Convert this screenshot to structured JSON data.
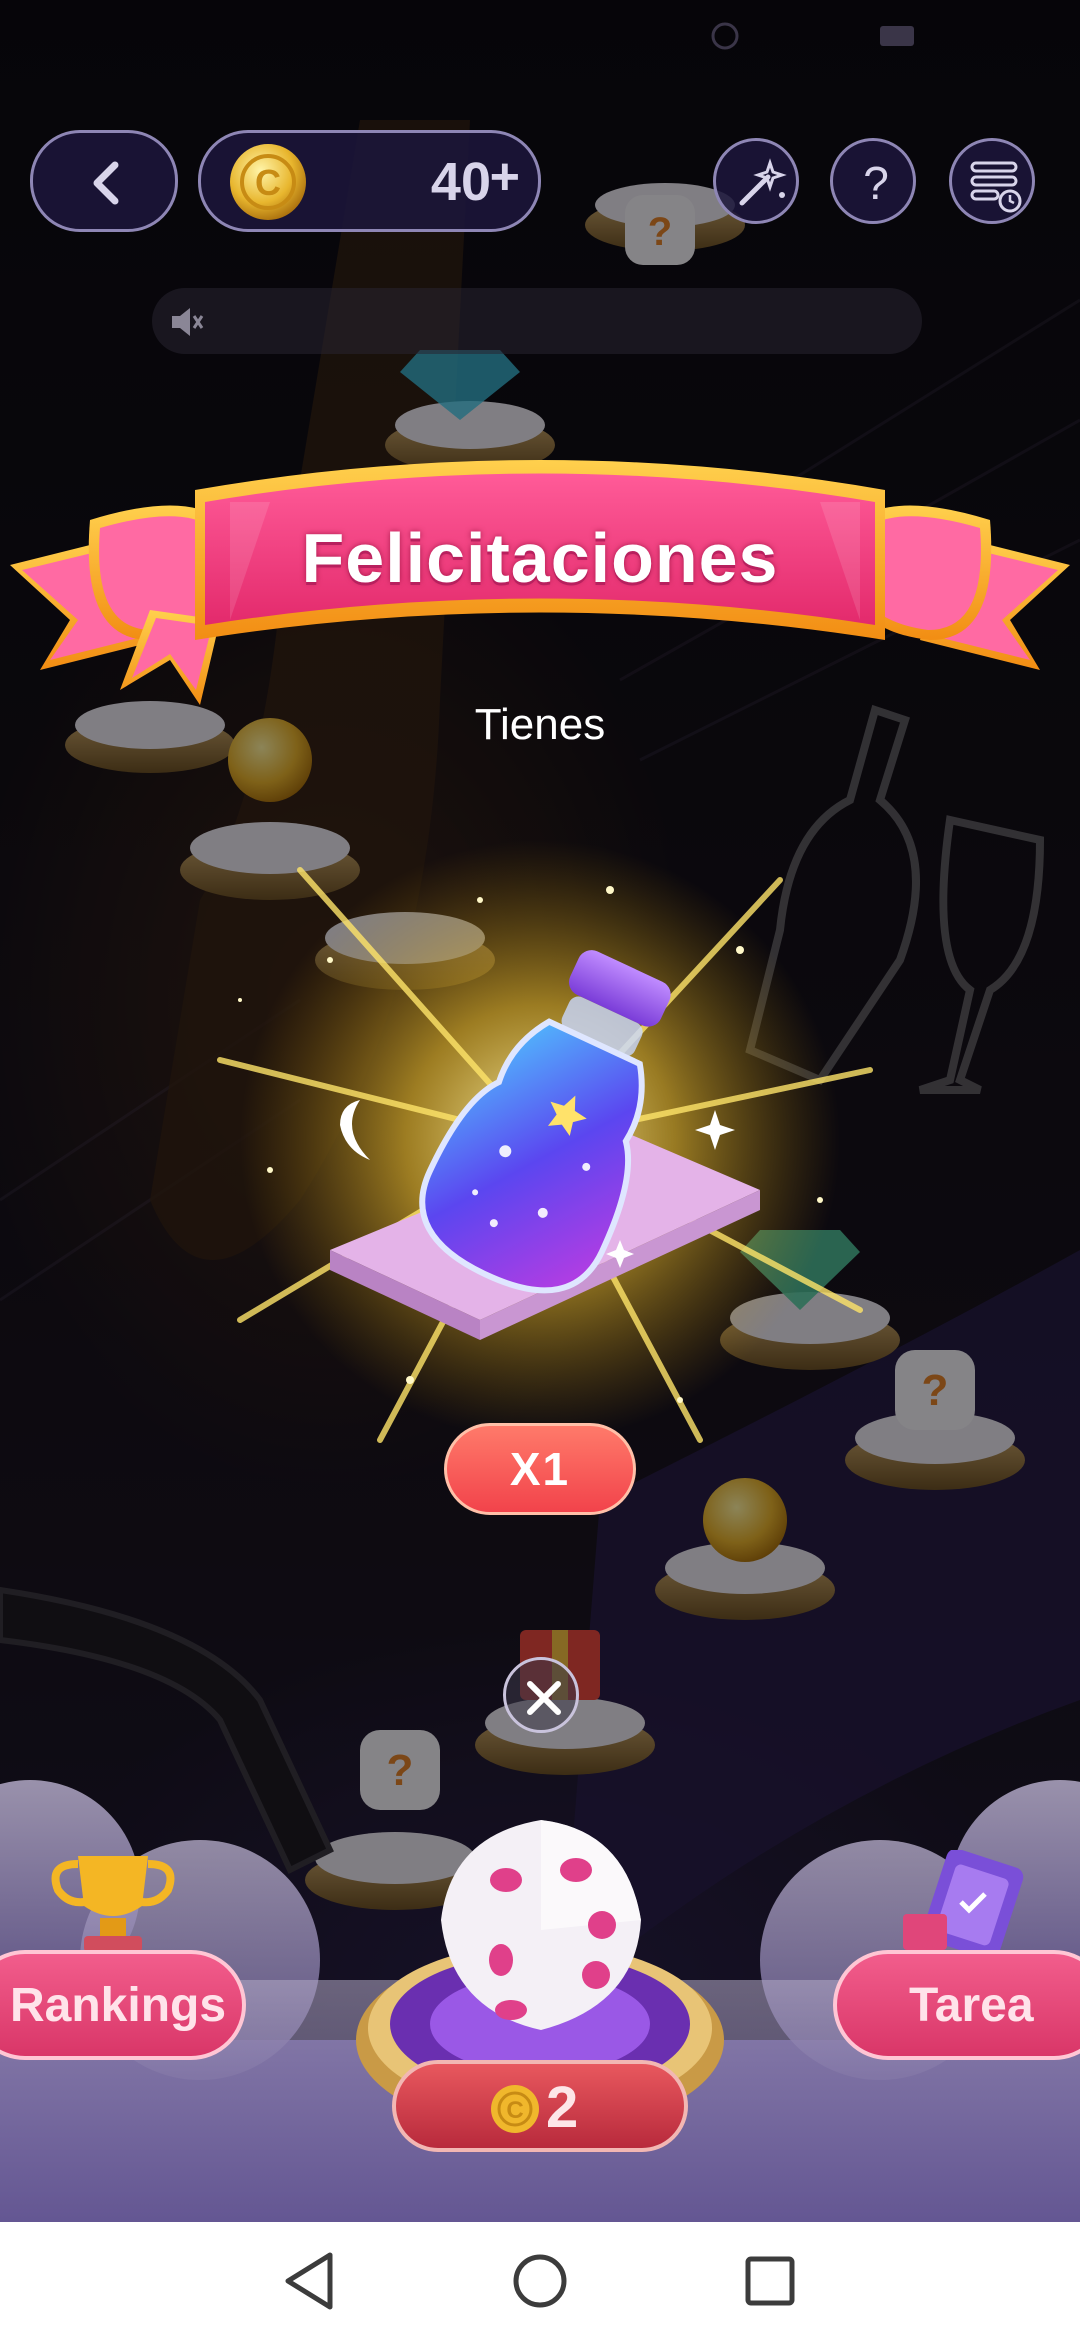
{
  "hud": {
    "coin_balance": "40",
    "coin_plus": "+"
  },
  "modal": {
    "title": "Felicitaciones",
    "subtitle": "Tienes",
    "reward_item_icon": "magic-potion-bottle-icon",
    "reward_quantity": "X1",
    "close_icon": "close-icon"
  },
  "bottom": {
    "rankings_label": "Rankings",
    "task_label": "Tarea",
    "roll_cost": "2",
    "dice_icon": "dice-icon"
  },
  "colors": {
    "banner_pink": "#f0427f",
    "banner_gold": "#f7a524",
    "pill_red": "#f2434b",
    "hud_border": "#8e86b5",
    "button_pink": "#d93668"
  }
}
